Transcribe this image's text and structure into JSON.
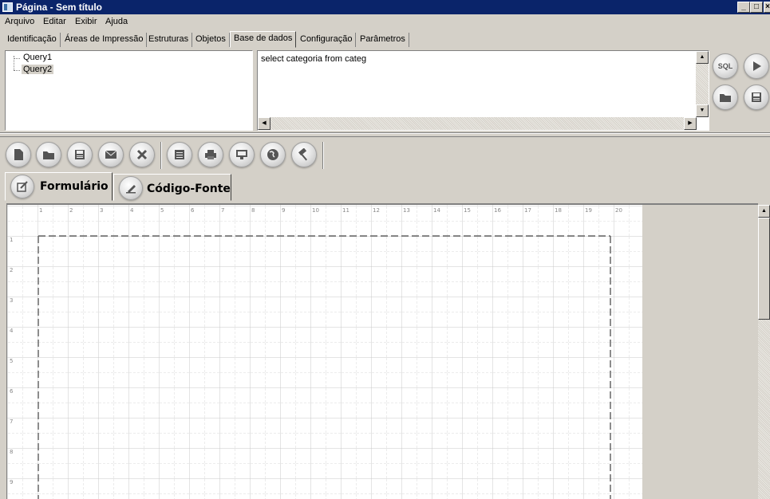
{
  "window": {
    "title": "Página - Sem título"
  },
  "menu": [
    "Arquivo",
    "Editar",
    "Exibir",
    "Ajuda"
  ],
  "tabs": [
    "Identificação",
    "Áreas de Impressão",
    "Estruturas",
    "Objetos",
    "Base de dados",
    "Configuração",
    "Parâmetros"
  ],
  "active_tab": "Base de dados",
  "tree": {
    "items": [
      "Query1",
      "Query2"
    ],
    "selected": "Query2"
  },
  "sql": {
    "text": "select categoria from categ"
  },
  "sql_buttons": {
    "sql_label": "SQL",
    "icons": [
      "sql-icon",
      "play-icon",
      "folder-icon",
      "save-icon"
    ]
  },
  "toolbar": {
    "icons": [
      "new-doc-icon",
      "folder-icon",
      "save-icon",
      "mail-icon",
      "close-icon",
      "form-icon",
      "print-icon",
      "monitor-icon",
      "globe-icon",
      "hammer-icon"
    ]
  },
  "view_tabs": [
    "Formulário",
    "Código-Fonte"
  ],
  "ruler": {
    "top": [
      "1",
      "2",
      "3",
      "4",
      "5",
      "6",
      "7",
      "8",
      "9",
      "10",
      "11",
      "12",
      "13",
      "14",
      "15",
      "16",
      "17",
      "18",
      "19",
      "20"
    ],
    "left": [
      "1",
      "2",
      "3",
      "4",
      "5",
      "6",
      "7",
      "8",
      "9"
    ]
  }
}
